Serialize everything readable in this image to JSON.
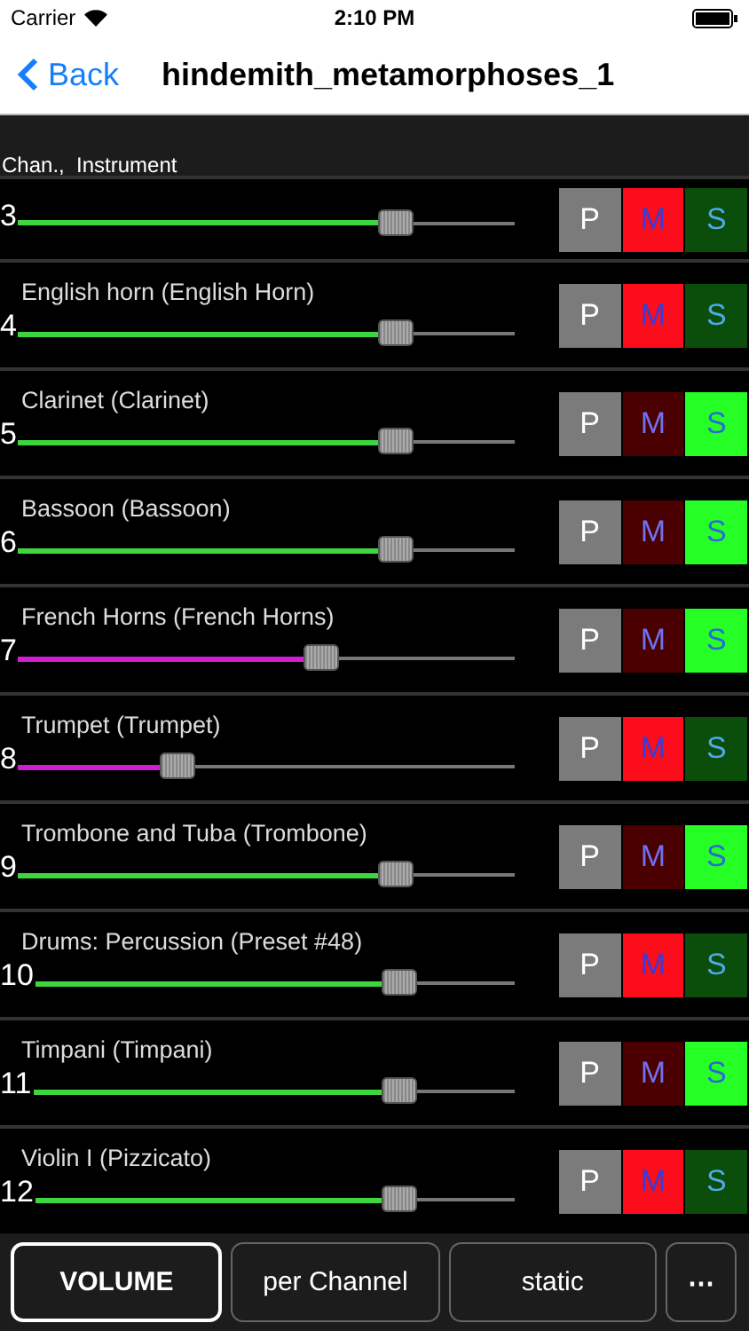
{
  "status_bar": {
    "carrier": "Carrier",
    "time": "2:10 PM"
  },
  "nav": {
    "back": "Back",
    "title": "hindemith_metamorphoses_1"
  },
  "list_header": "Chan.,  Instrument",
  "channels": [
    {
      "number": "3",
      "level": 0.76,
      "color": "#3ed63e",
      "p": "P",
      "m": "M",
      "s": "S",
      "muted": true,
      "solo": false
    },
    {
      "name": "English horn (English Horn)",
      "number": "4",
      "level": 0.76,
      "color": "#3ed63e",
      "p": "P",
      "m": "M",
      "s": "S",
      "muted": true,
      "solo": false
    },
    {
      "name": "Clarinet (Clarinet)",
      "number": "5",
      "level": 0.76,
      "color": "#3ed63e",
      "p": "P",
      "m": "M",
      "s": "S",
      "muted": false,
      "solo": true
    },
    {
      "name": "Bassoon (Bassoon)",
      "number": "6",
      "level": 0.76,
      "color": "#3ed63e",
      "p": "P",
      "m": "M",
      "s": "S",
      "muted": false,
      "solo": true
    },
    {
      "name": "French Horns (French Horns)",
      "number": "7",
      "level": 0.61,
      "color": "#d21ed2",
      "p": "P",
      "m": "M",
      "s": "S",
      "muted": false,
      "solo": true
    },
    {
      "name": "Trumpet (Trumpet)",
      "number": "8",
      "level": 0.32,
      "color": "#d21ed2",
      "p": "P",
      "m": "M",
      "s": "S",
      "muted": true,
      "solo": false
    },
    {
      "name": "Trombone and Tuba (Trombone)",
      "number": "9",
      "level": 0.76,
      "color": "#3ed63e",
      "p": "P",
      "m": "M",
      "s": "S",
      "muted": false,
      "solo": true
    },
    {
      "name": "Drums: Percussion (Preset #48)",
      "number": "10",
      "level": 0.76,
      "color": "#3ed63e",
      "p": "P",
      "m": "M",
      "s": "S",
      "muted": true,
      "solo": false
    },
    {
      "name": "Timpani (Timpani)",
      "number": "11",
      "level": 0.76,
      "color": "#3ed63e",
      "p": "P",
      "m": "M",
      "s": "S",
      "muted": false,
      "solo": true
    },
    {
      "name": "Violin I (Pizzicato)",
      "number": "12",
      "level": 0.76,
      "color": "#3ed63e",
      "p": "P",
      "m": "M",
      "s": "S",
      "muted": true,
      "solo": false
    }
  ],
  "toolbar": [
    {
      "label": "VOLUME",
      "selected": true
    },
    {
      "label": "per Channel",
      "selected": false
    },
    {
      "label": "static",
      "selected": false
    },
    {
      "label": "⋯",
      "selected": false
    }
  ]
}
